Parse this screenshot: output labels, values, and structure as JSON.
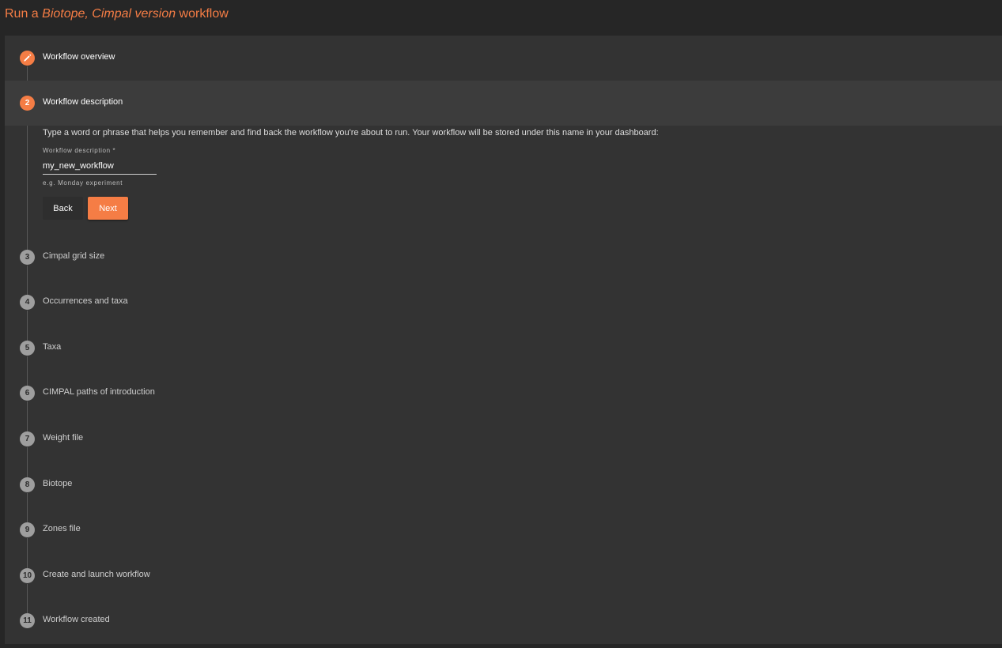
{
  "header": {
    "title_prefix": "Run a ",
    "title_italic": "Biotope, Cimpal version",
    "title_suffix": " workflow",
    "accent_color": "#f57d45"
  },
  "steps": [
    {
      "number": "",
      "icon": "pencil-icon",
      "label": "Workflow overview"
    },
    {
      "number": "2",
      "label": "Workflow description"
    },
    {
      "number": "3",
      "label": "Cimpal grid size"
    },
    {
      "number": "4",
      "label": "Occurrences and taxa"
    },
    {
      "number": "5",
      "label": "Taxa"
    },
    {
      "number": "6",
      "label": "CIMPAL paths of introduction"
    },
    {
      "number": "7",
      "label": "Weight file"
    },
    {
      "number": "8",
      "label": "Biotope"
    },
    {
      "number": "9",
      "label": "Zones file"
    },
    {
      "number": "10",
      "label": "Create and launch workflow"
    },
    {
      "number": "11",
      "label": "Workflow created"
    }
  ],
  "description_step": {
    "instructions": "Type a word or phrase that helps you remember and find back the workflow you're about to run. Your workflow will be stored under this name in your dashboard:",
    "field_label": "Workflow description *",
    "field_value": "my_new_workflow",
    "field_hint": "e.g. Monday experiment",
    "back_label": "Back",
    "next_label": "Next"
  }
}
